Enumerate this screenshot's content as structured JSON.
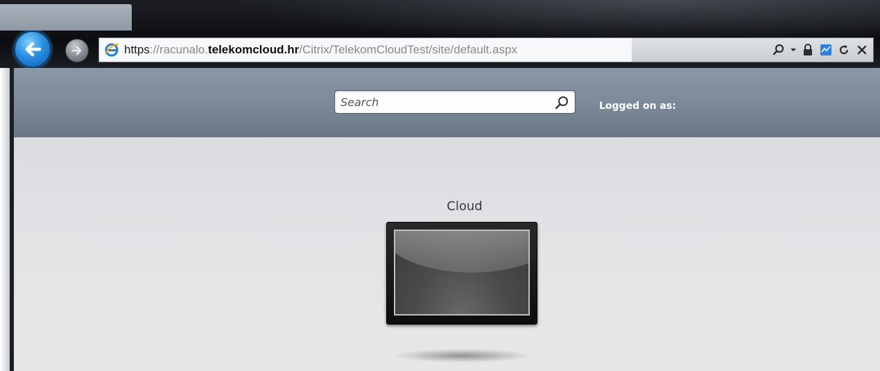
{
  "browser": {
    "url": {
      "scheme": "https",
      "pre_host": "://racunalo.",
      "domain": "telekomcloud.hr",
      "path": "/Citrix/TelekomCloudTest/site/default.aspx"
    },
    "icons": {
      "back": "back-arrow-icon",
      "forward": "forward-arrow-icon",
      "site": "ie-logo-icon",
      "search": "search-icon",
      "dropdown": "chevron-down-icon",
      "lock": "lock-icon",
      "compat": "compatibility-view-icon",
      "refresh": "refresh-icon",
      "stop": "close-icon"
    }
  },
  "header": {
    "search_placeholder": "Search",
    "logged_on_label": "Logged on as:"
  },
  "apps": [
    {
      "label": "Cloud",
      "icon": "desktop-monitor-icon"
    }
  ],
  "colors": {
    "header_bar": "#7a8898",
    "back_button": "#2a8fe0",
    "page_background": "#e2e4e6"
  }
}
